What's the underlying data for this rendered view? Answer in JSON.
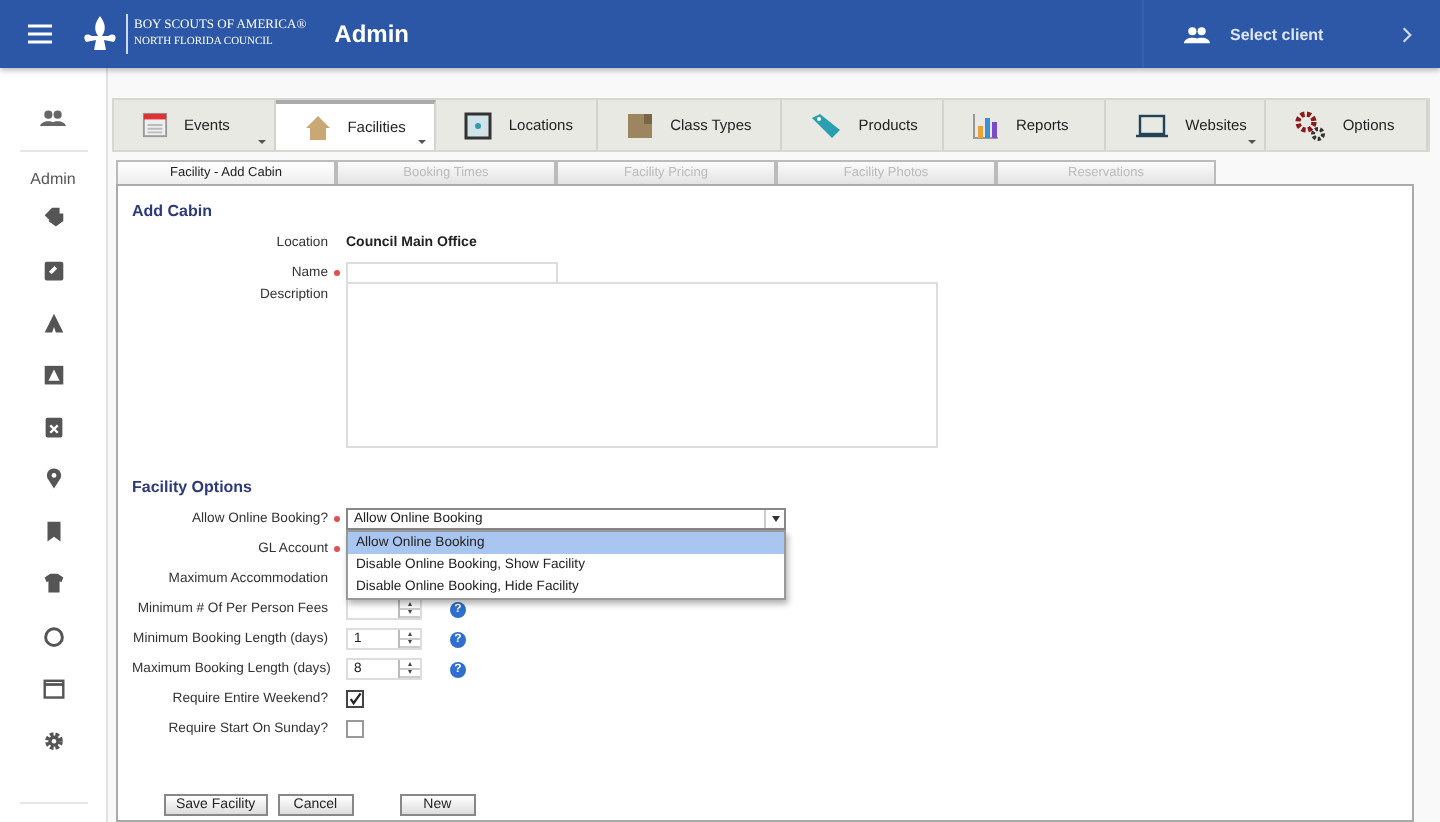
{
  "header": {
    "org_line_1": "BOY SCOUTS OF AMERICA®",
    "org_line_2": "NORTH FLORIDA COUNCIL",
    "title": "Admin",
    "client_button": "Select client"
  },
  "sidebar": {
    "label": "Admin"
  },
  "tabs": [
    {
      "label": "Events",
      "kind": "events",
      "selected": false,
      "has_menu": true
    },
    {
      "label": "Facilities",
      "kind": "facilities",
      "selected": true,
      "has_menu": true
    },
    {
      "label": "Locations",
      "kind": "locations",
      "selected": false,
      "has_menu": false
    },
    {
      "label": "Class Types",
      "kind": "classes",
      "selected": false,
      "has_menu": false
    },
    {
      "label": "Products",
      "kind": "products",
      "selected": false,
      "has_menu": false
    },
    {
      "label": "Reports",
      "kind": "reports",
      "selected": false,
      "has_menu": false
    },
    {
      "label": "Websites",
      "kind": "websites",
      "selected": false,
      "has_menu": true
    },
    {
      "label": "Options",
      "kind": "options",
      "selected": false,
      "has_menu": false
    }
  ],
  "subtabs": [
    {
      "label": "Facility - Add Cabin",
      "selected": true
    },
    {
      "label": "Booking Times",
      "selected": false
    },
    {
      "label": "Facility Pricing",
      "selected": false
    },
    {
      "label": "Facility Photos",
      "selected": false
    },
    {
      "label": "Reservations",
      "selected": false
    }
  ],
  "add_cabin": {
    "heading": "Add Cabin",
    "fields": [
      {
        "label": "Location",
        "kind": "static",
        "required": false,
        "value": "Council Main Office"
      },
      {
        "label": "Name",
        "kind": "text",
        "required": true
      },
      {
        "label": "Description",
        "kind": "textarea",
        "required": false
      }
    ]
  },
  "facility_options": {
    "heading": "Facility Options",
    "fields": [
      {
        "label": "Allow Online Booking?",
        "kind": "select",
        "required": true,
        "value": "Allow Online Booking",
        "expanded": true,
        "options": [
          {
            "label": "Allow Online Booking",
            "selected": true
          },
          {
            "label": "Disable Online Booking, Show Facility",
            "selected": false
          },
          {
            "label": "Disable Online Booking, Hide Facility",
            "selected": false
          }
        ]
      },
      {
        "label": "GL Account",
        "kind": "covered",
        "required": true
      },
      {
        "label": "Maximum Accommodation",
        "kind": "covered",
        "required": false
      },
      {
        "label": "Minimum # Of Per Person Fees",
        "kind": "number",
        "required": false,
        "help": "?"
      },
      {
        "label": "Minimum Booking Length (days)",
        "kind": "number",
        "required": false,
        "value": "1",
        "help": "?"
      },
      {
        "label": "Maximum Booking Length (days)",
        "kind": "number",
        "required": false,
        "value": "8",
        "help": "?"
      },
      {
        "label": "Require Entire Weekend?",
        "kind": "checkbox",
        "checked": true
      },
      {
        "label": "Require Start On Sunday?",
        "kind": "checkbox",
        "checked": false
      }
    ]
  },
  "buttons": [
    {
      "label": "Save Facility"
    },
    {
      "label": "Cancel"
    },
    {
      "label": "New"
    }
  ]
}
